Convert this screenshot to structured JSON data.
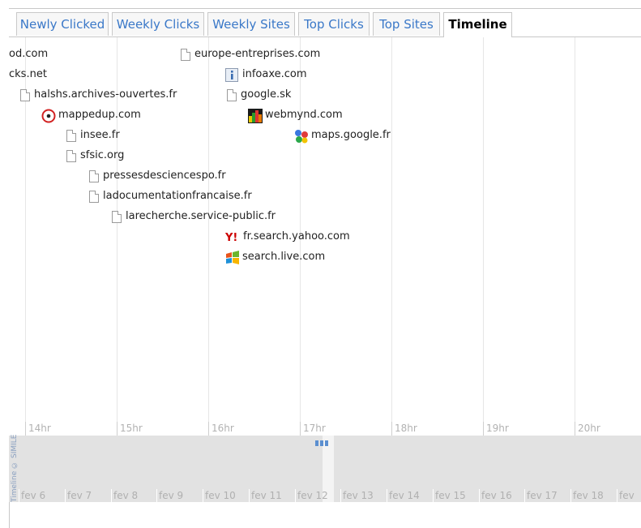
{
  "tabs": [
    {
      "label": "Newly Clicked"
    },
    {
      "label": "Weekly Clicks"
    },
    {
      "label": "Weekly Sites"
    },
    {
      "label": "Top Clicks"
    },
    {
      "label": "Top Sites"
    },
    {
      "label": "Timeline",
      "active": true
    }
  ],
  "timeline": {
    "hours": [
      "14hr",
      "15hr",
      "16hr",
      "17hr",
      "18hr",
      "19hr",
      "20hr"
    ],
    "events": [
      {
        "label": "od.com",
        "icon": "document-icon"
      },
      {
        "label": "cks.net",
        "icon": "document-icon"
      },
      {
        "label": "halshs.archives-ouvertes.fr",
        "icon": "document-icon"
      },
      {
        "label": "mappedup.com",
        "icon": "target-icon"
      },
      {
        "label": "insee.fr",
        "icon": "document-icon"
      },
      {
        "label": "sfsic.org",
        "icon": "document-icon"
      },
      {
        "label": "pressesdesciencespo.fr",
        "icon": "document-icon"
      },
      {
        "label": "ladocumentationfrancaise.fr",
        "icon": "document-icon"
      },
      {
        "label": "larecherche.service-public.fr",
        "icon": "document-icon"
      },
      {
        "label": "europe-entreprises.com",
        "icon": "document-icon"
      },
      {
        "label": "infoaxe.com",
        "icon": "info-icon"
      },
      {
        "label": "google.sk",
        "icon": "document-icon"
      },
      {
        "label": "webmynd.com",
        "icon": "webmynd-icon"
      },
      {
        "label": "maps.google.fr",
        "icon": "google-maps-icon"
      },
      {
        "label": "fr.search.yahoo.com",
        "icon": "yahoo-icon"
      },
      {
        "label": "search.live.com",
        "icon": "windows-icon"
      }
    ]
  },
  "overview": {
    "days": [
      "fev 6",
      "fev 7",
      "fev 8",
      "fev 9",
      "fev 10",
      "fev 11",
      "fev 12",
      "fev 13",
      "fev 14",
      "fev 15",
      "fev 16",
      "fev 17",
      "fev 18",
      "fev"
    ],
    "credit": "Timeline © SIMILE"
  },
  "colors": {
    "tab_text": "#3a78c8",
    "marker": "#5b8fd0",
    "yahoo": "#cc0000",
    "target": "#d22222"
  }
}
